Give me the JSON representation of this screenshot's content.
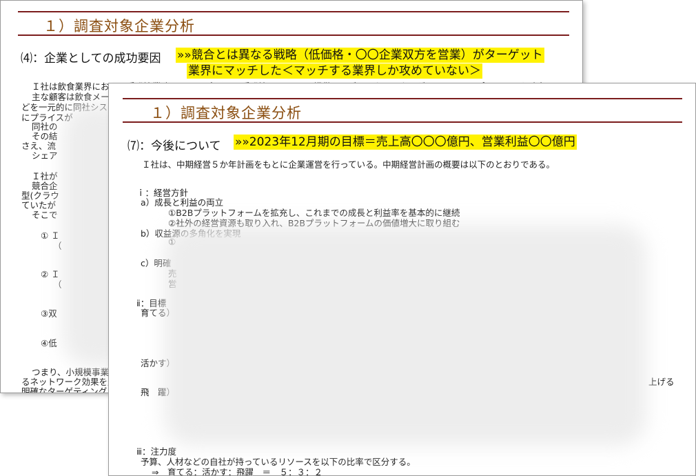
{
  "back_slide": {
    "title": "１）調査対象企業分析",
    "section_label": "⑷：企業としての成功要因",
    "highlight_line1": "»»競合とは異なる戦略（低価格・〇〇企業双方を営業）がターゲット",
    "highlight_line2": "業界にマッチした＜マッチする業界しか攻めていない＞",
    "body_lines": [
      "Ｉ社は飲食業界における受発注業務　フードプレイス(受発注システム)の提供で、デファクトスタンダードとしてのポジションを確立している",
      "主な顧客は飲食メーカ",
      "どを一元的に同社シス",
      "にプライスが",
      "同社の",
      "その結",
      "さえ、流",
      "シェア",
      "Ｉ社が",
      "競合企",
      "型(クラウ",
      "ていたが",
      "そこで",
      "① Ｉ",
      "（",
      "② Ｉ",
      "（",
      "③双",
      "④低",
      "つまり、小規模事業所",
      "るネットワーク効果を生",
      "明確なターゲティング"
    ]
  },
  "front_slide": {
    "title": "１）調査対象企業分析",
    "section_label": "⑺：今後について",
    "highlight": "»»2023年12月期の目標＝売上高〇〇〇億円、営業利益〇〇億円",
    "intro": "Ｉ社は、中期経営５か年計画をもとに企業運営を行っている。中期経営計画の概要は以下のとおりである。",
    "heading_i": "ｉ：経営方針",
    "item_a": "a）成長と利益の両立",
    "item_a1": "①B2Bプラットフォームを拡充し、これまでの成長と利益率を基本的に継続",
    "item_a2": "②社外の経営資源も取り入れ、B2Bプラットフォームの価値増大に取り組む",
    "item_b": "b）収益源の多角化を実現",
    "item_b1": "①",
    "item_c": "c）明確",
    "item_c_frag1": "売",
    "item_c_frag2": "営",
    "heading_ii": "ⅱ：目標",
    "grow": "育てる）",
    "use": "活かす）",
    "leap": "飛　躍）",
    "right_frag": "上げる",
    "heading_iii": "ⅲ：注力度",
    "budget": "予算、人材などの自社が持っているリソースを以下の比率で区分する。",
    "ratio": "⇒　育てる：活かす：飛躍　＝　５：３：２"
  }
}
